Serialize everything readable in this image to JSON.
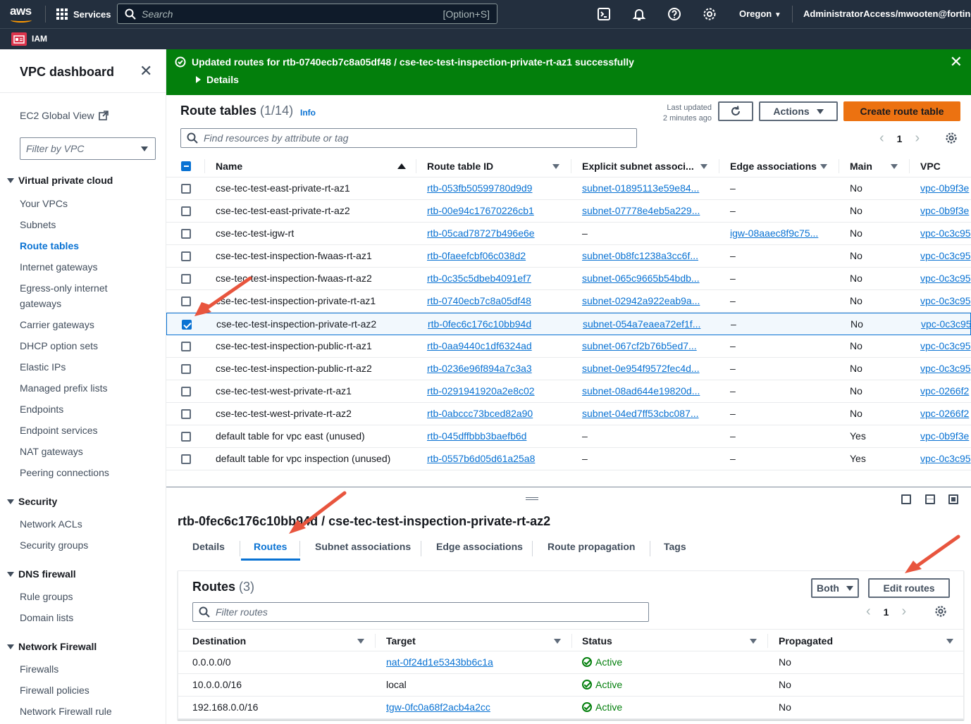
{
  "topnav": {
    "logo_text": "aws",
    "services_label": "Services",
    "search_placeholder": "Search",
    "search_shortcut": "[Option+S]",
    "region": "Oregon",
    "account": "AdministratorAccess/mwooten@fortinet.co"
  },
  "subnav": {
    "service_label": "IAM"
  },
  "sidebar": {
    "title": "VPC dashboard",
    "ec2_global_view": "EC2 Global View",
    "filter_placeholder": "Filter by VPC",
    "sections": [
      {
        "heading": "Virtual private cloud",
        "items": [
          "Your VPCs",
          "Subnets",
          "Route tables",
          "Internet gateways",
          "Egress-only internet gateways",
          "Carrier gateways",
          "DHCP option sets",
          "Elastic IPs",
          "Managed prefix lists",
          "Endpoints",
          "Endpoint services",
          "NAT gateways",
          "Peering connections"
        ]
      },
      {
        "heading": "Security",
        "items": [
          "Network ACLs",
          "Security groups"
        ]
      },
      {
        "heading": "DNS firewall",
        "items": [
          "Rule groups",
          "Domain lists"
        ]
      },
      {
        "heading": "Network Firewall",
        "items": [
          "Firewalls",
          "Firewall policies",
          "Network Firewall rule"
        ]
      }
    ],
    "active_item": "Route tables"
  },
  "flash": {
    "message": "Updated routes for rtb-0740ecb7c8a05df48 / cse-tec-test-inspection-private-rt-az1 successfully",
    "details_label": "Details",
    "color": "#037f0c"
  },
  "route_tables": {
    "title": "Route tables",
    "count": "(1/14)",
    "info": "Info",
    "last_updated_line1": "Last updated",
    "last_updated_line2": "2 minutes ago",
    "actions_label": "Actions",
    "create_label": "Create route table",
    "search_placeholder": "Find resources by attribute or tag",
    "page": "1",
    "columns": [
      "Name",
      "Route table ID",
      "Explicit subnet associ...",
      "Edge associations",
      "Main",
      "VPC"
    ],
    "rows": [
      {
        "name": "cse-tec-test-east-private-rt-az1",
        "id": "rtb-053fb50599780d9d9",
        "subnet": "subnet-01895113e59e84...",
        "edge": "–",
        "main": "No",
        "vpc": "vpc-0b9f3e",
        "checked": false
      },
      {
        "name": "cse-tec-test-east-private-rt-az2",
        "id": "rtb-00e94c17670226cb1",
        "subnet": "subnet-07778e4eb5a229...",
        "edge": "–",
        "main": "No",
        "vpc": "vpc-0b9f3e",
        "checked": false
      },
      {
        "name": "cse-tec-test-igw-rt",
        "id": "rtb-05cad78727b496e6e",
        "subnet": "–",
        "edge": "igw-08aaec8f9c75...",
        "main": "No",
        "vpc": "vpc-0c3c95",
        "checked": false
      },
      {
        "name": "cse-tec-test-inspection-fwaas-rt-az1",
        "id": "rtb-0faeefcbf06c038d2",
        "subnet": "subnet-0b8fc1238a3cc6f...",
        "edge": "–",
        "main": "No",
        "vpc": "vpc-0c3c95",
        "checked": false
      },
      {
        "name": "cse-tec-test-inspection-fwaas-rt-az2",
        "id": "rtb-0c35c5dbeb4091ef7",
        "subnet": "subnet-065c9665b54bdb...",
        "edge": "–",
        "main": "No",
        "vpc": "vpc-0c3c95",
        "checked": false
      },
      {
        "name": "cse-tec-test-inspection-private-rt-az1",
        "id": "rtb-0740ecb7c8a05df48",
        "subnet": "subnet-02942a922eab9a...",
        "edge": "–",
        "main": "No",
        "vpc": "vpc-0c3c95",
        "checked": false
      },
      {
        "name": "cse-tec-test-inspection-private-rt-az2",
        "id": "rtb-0fec6c176c10bb94d",
        "subnet": "subnet-054a7eaea72ef1f...",
        "edge": "–",
        "main": "No",
        "vpc": "vpc-0c3c95",
        "checked": true
      },
      {
        "name": "cse-tec-test-inspection-public-rt-az1",
        "id": "rtb-0aa9440c1df6324ad",
        "subnet": "subnet-067cf2b76b5ed7...",
        "edge": "–",
        "main": "No",
        "vpc": "vpc-0c3c95",
        "checked": false
      },
      {
        "name": "cse-tec-test-inspection-public-rt-az2",
        "id": "rtb-0236e96f894a7c3a3",
        "subnet": "subnet-0e954f9572fec4d...",
        "edge": "–",
        "main": "No",
        "vpc": "vpc-0c3c95",
        "checked": false
      },
      {
        "name": "cse-tec-test-west-private-rt-az1",
        "id": "rtb-0291941920a2e8c02",
        "subnet": "subnet-08ad644e19820d...",
        "edge": "–",
        "main": "No",
        "vpc": "vpc-0266f2",
        "checked": false
      },
      {
        "name": "cse-tec-test-west-private-rt-az2",
        "id": "rtb-0abccc73bced82a90",
        "subnet": "subnet-04ed7ff53cbc087...",
        "edge": "–",
        "main": "No",
        "vpc": "vpc-0266f2",
        "checked": false
      },
      {
        "name": "default table for vpc east (unused)",
        "id": "rtb-045dffbbb3baefb6d",
        "subnet": "–",
        "edge": "–",
        "main": "Yes",
        "vpc": "vpc-0b9f3e",
        "checked": false
      },
      {
        "name": "default table for vpc inspection (unused)",
        "id": "rtb-0557b6d05d61a25a8",
        "subnet": "–",
        "edge": "–",
        "main": "Yes",
        "vpc": "vpc-0c3c95",
        "checked": false
      }
    ]
  },
  "detail": {
    "title": "rtb-0fec6c176c10bb94d / cse-tec-test-inspection-private-rt-az2",
    "tabs": [
      "Details",
      "Routes",
      "Subnet associations",
      "Edge associations",
      "Route propagation",
      "Tags"
    ],
    "active_tab": "Routes",
    "routes_title": "Routes",
    "routes_count": "(3)",
    "both_label": "Both",
    "edit_label": "Edit routes",
    "filter_placeholder": "Filter routes",
    "page": "1",
    "columns": [
      "Destination",
      "Target",
      "Status",
      "Propagated"
    ],
    "rows": [
      {
        "destination": "0.0.0.0/0",
        "target": "nat-0f24d1e5343bb6c1a",
        "target_link": true,
        "status": "Active",
        "propagated": "No"
      },
      {
        "destination": "10.0.0.0/16",
        "target": "local",
        "target_link": false,
        "status": "Active",
        "propagated": "No"
      },
      {
        "destination": "192.168.0.0/16",
        "target": "tgw-0fc0a68f2acb4a2cc",
        "target_link": true,
        "status": "Active",
        "propagated": "No"
      }
    ]
  }
}
